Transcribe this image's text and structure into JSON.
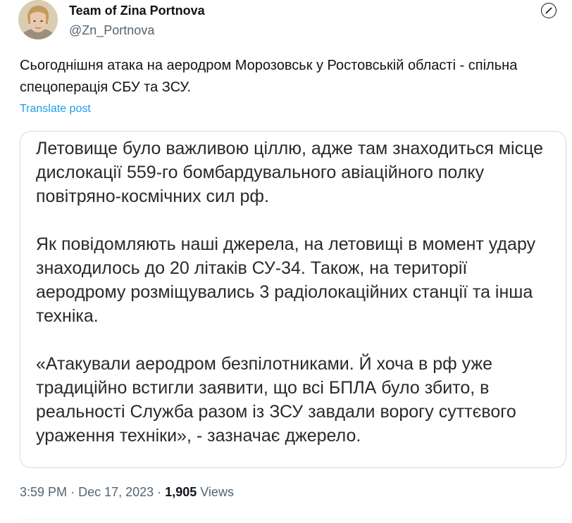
{
  "author": {
    "name": "Team of Zina Portnova",
    "handle": "@Zn_Portnova"
  },
  "tweet": {
    "text": "Сьогоднішня атака на аеродром Морозовськ у Ростовській області - спільна спецоперація СБУ та ЗСУ.",
    "translate_label": "Translate post"
  },
  "card": {
    "paragraphs": [
      "Летовище було важливою ціллю, адже там знаходиться місце дислокації 559-го бомбардувального авіаційного полку повітряно-космічних сил рф.",
      "Як повідомляють наші джерела, на летовищі в момент удару знаходилось до 20 літаків СУ-34. Також, на території аеродрому розміщувались 3 радіолокаційних станції та інша техніка.",
      "«Атакували аеродром безпілотниками. Й хоча в рф уже традиційно встигли заявити, що всі БПЛА було збито, в реальності Служба разом із ЗСУ завдали ворогу суттєвого ураження техніки», - зазначає джерело."
    ]
  },
  "meta": {
    "time": "3:59 PM",
    "separator": "·",
    "date": "Dec 17, 2023",
    "views_count": "1,905",
    "views_label": "Views"
  },
  "colors": {
    "text": "#0f1419",
    "secondary": "#536471",
    "link": "#1d9bf0",
    "border": "#cfd9de"
  },
  "icons": {
    "more": "grok-icon"
  }
}
